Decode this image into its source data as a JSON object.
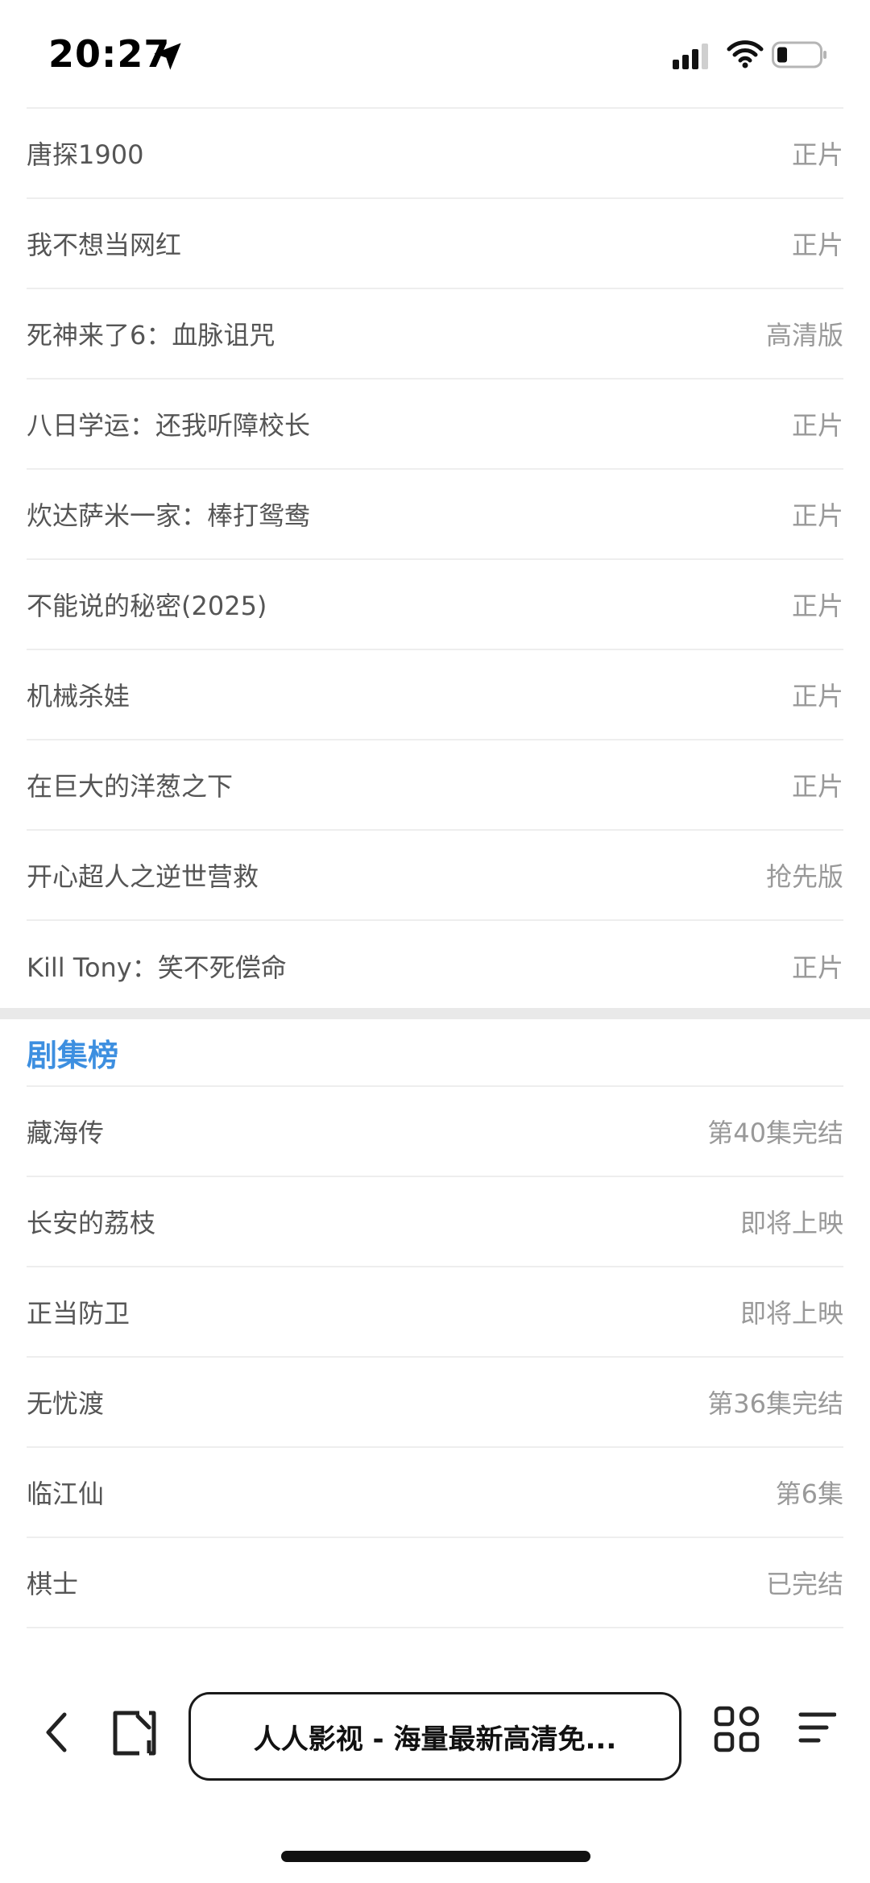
{
  "status_bar": {
    "time": "20:27"
  },
  "movies": [
    {
      "title": "唐探1900",
      "status": "正片"
    },
    {
      "title": "我不想当网红",
      "status": "正片"
    },
    {
      "title": "死神来了6：血脉诅咒",
      "status": "高清版"
    },
    {
      "title": "八日学运：还我听障校长",
      "status": "正片"
    },
    {
      "title": "炊达萨米一家：棒打鸳鸯",
      "status": "正片"
    },
    {
      "title": "不能说的秘密(2025)",
      "status": "正片"
    },
    {
      "title": "机械杀娃",
      "status": "正片"
    },
    {
      "title": "在巨大的洋葱之下",
      "status": "正片"
    },
    {
      "title": "开心超人之逆世营救",
      "status": "抢先版"
    },
    {
      "title": "Kill Tony：笑不死偿命",
      "status": "正片"
    }
  ],
  "series_section": {
    "heading": "剧集榜",
    "items": [
      {
        "title": "藏海传",
        "status": "第40集完结"
      },
      {
        "title": "长安的荔枝",
        "status": "即将上映"
      },
      {
        "title": "正当防卫",
        "status": "即将上映"
      },
      {
        "title": "无忧渡",
        "status": "第36集完结"
      },
      {
        "title": "临江仙",
        "status": "第6集"
      },
      {
        "title": "棋士",
        "status": "已完结"
      }
    ]
  },
  "browser": {
    "address_title": "人人影视 - 海量最新高清免..."
  }
}
